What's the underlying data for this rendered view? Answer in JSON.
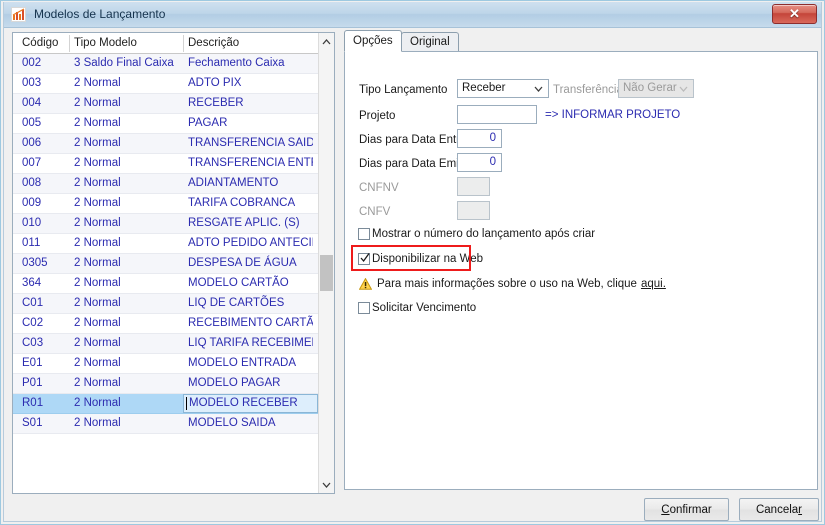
{
  "window": {
    "title": "Modelos de Lançamento",
    "icon": "app-icon",
    "close_label": "✕"
  },
  "grid": {
    "columns": [
      "Código",
      "Tipo Modelo",
      "Descrição"
    ],
    "rows": [
      {
        "codigo": "002",
        "tipo": "3 Saldo Final Caixa",
        "descricao": "Fechamento Caixa"
      },
      {
        "codigo": "003",
        "tipo": "2 Normal",
        "descricao": "ADTO PIX"
      },
      {
        "codigo": "004",
        "tipo": "2 Normal",
        "descricao": "RECEBER"
      },
      {
        "codigo": "005",
        "tipo": "2 Normal",
        "descricao": "PAGAR"
      },
      {
        "codigo": "006",
        "tipo": "2 Normal",
        "descricao": "TRANSFERENCIA SAIDA"
      },
      {
        "codigo": "007",
        "tipo": "2 Normal",
        "descricao": "TRANSFERENCIA ENTRAD"
      },
      {
        "codigo": "008",
        "tipo": "2 Normal",
        "descricao": "ADIANTAMENTO"
      },
      {
        "codigo": "009",
        "tipo": "2 Normal",
        "descricao": "TARIFA COBRANCA"
      },
      {
        "codigo": "010",
        "tipo": "2 Normal",
        "descricao": "RESGATE APLIC. (S)"
      },
      {
        "codigo": "011",
        "tipo": "2 Normal",
        "descricao": "ADTO PEDIDO ANTECIP"
      },
      {
        "codigo": "0305",
        "tipo": "2 Normal",
        "descricao": "DESPESA DE ÁGUA"
      },
      {
        "codigo": "364",
        "tipo": "2 Normal",
        "descricao": "MODELO CARTÃO"
      },
      {
        "codigo": "C01",
        "tipo": "2 Normal",
        "descricao": "LIQ DE CARTÕES"
      },
      {
        "codigo": "C02",
        "tipo": "2 Normal",
        "descricao": "RECEBIMENTO CARTÃO"
      },
      {
        "codigo": "C03",
        "tipo": "2 Normal",
        "descricao": "LIQ TARIFA RECEBIMEN"
      },
      {
        "codigo": "E01",
        "tipo": "2 Normal",
        "descricao": "MODELO ENTRADA"
      },
      {
        "codigo": "P01",
        "tipo": "2 Normal",
        "descricao": "MODELO PAGAR"
      },
      {
        "codigo": "R01",
        "tipo": "2 Normal",
        "descricao": "MODELO RECEBER",
        "selected": true
      },
      {
        "codigo": "S01",
        "tipo": "2 Normal",
        "descricao": "MODELO SAIDA"
      }
    ]
  },
  "tabs": [
    {
      "label": "Opções",
      "active": true
    },
    {
      "label": "Original",
      "active": false
    }
  ],
  "form": {
    "tipo_lancamento_label": "Tipo Lançamento",
    "tipo_lancamento_value": "Receber",
    "transferencia_label": "Transferência",
    "transferencia_value": "Não Gerar",
    "projeto_label": "Projeto",
    "projeto_value": "",
    "projeto_hint": "=> INFORMAR PROJETO",
    "dias_data_entrada_label": "Dias para Data Entrada",
    "dias_data_entrada_value": "0",
    "dias_data_emissao_label": "Dias para Data Emissão",
    "dias_data_emissao_value": "0",
    "cnfnv_label": "CNFNV",
    "cnfnv_value": "",
    "cnfv_label": "CNFV",
    "cnfv_value": "",
    "mostrar_numero_label": "Mostrar o número do lançamento após criar",
    "mostrar_numero_checked": false,
    "disponibilizar_web_label": "Disponibilizar na Web",
    "disponibilizar_web_checked": true,
    "warning_text": "Para mais informações sobre o uso na Web, clique",
    "warning_link": "aqui.",
    "solicitar_vencimento_label": "Solicitar Vencimento",
    "solicitar_vencimento_checked": false
  },
  "footer": {
    "confirmar_label": "Confirmar",
    "confirmar_accel": "C",
    "confirmar_rest": "onfirmar",
    "cancelar_label": "Cancelar",
    "cancelar_head": "Cancela",
    "cancelar_accel": "r"
  },
  "colors": {
    "grid_text": "#2b2bb0",
    "selection": "#aed8f6",
    "highlight_box": "#ee1b1b",
    "titlebar": "#bed6e9",
    "link": "#2b2bb0"
  }
}
